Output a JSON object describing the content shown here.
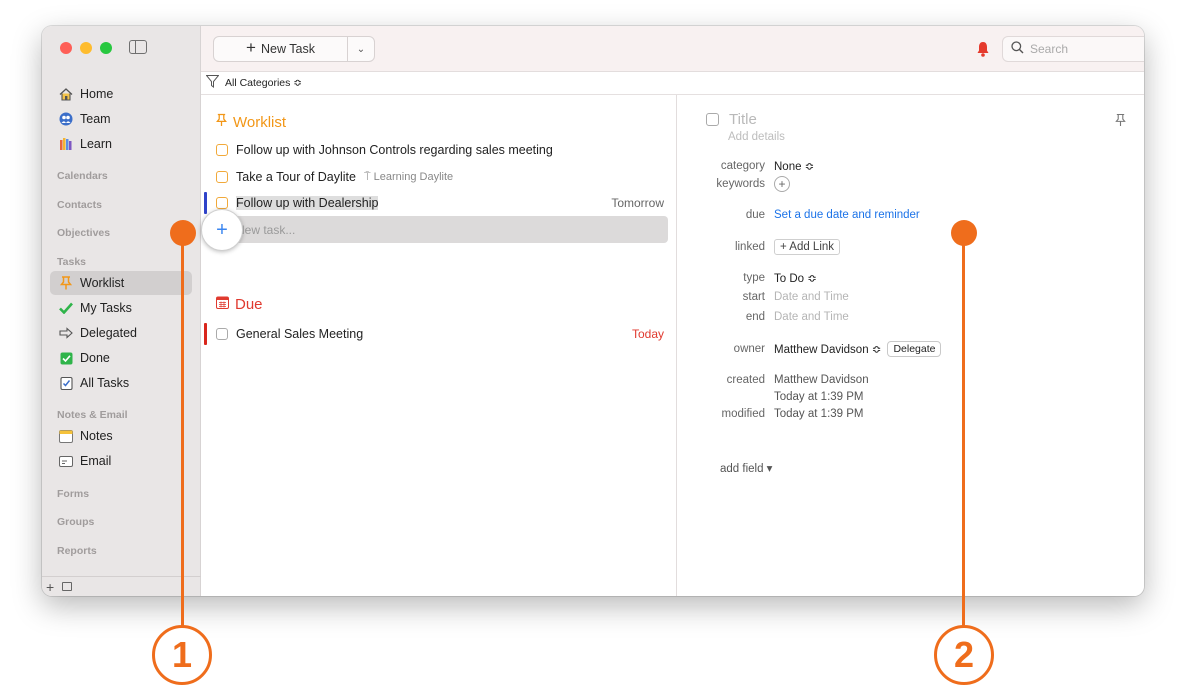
{
  "sidebar": {
    "items": [
      {
        "label": "Home",
        "icon": "home-icon"
      },
      {
        "label": "Team",
        "icon": "team-icon"
      },
      {
        "label": "Learn",
        "icon": "learn-icon"
      }
    ],
    "sections": {
      "calendars": "Calendars",
      "contacts": "Contacts",
      "objectives": "Objectives",
      "tasks": "Tasks",
      "notes_email": "Notes & Email",
      "forms": "Forms",
      "groups": "Groups",
      "reports": "Reports"
    },
    "task_items": [
      {
        "label": "Worklist",
        "icon": "pin-icon",
        "selected": true
      },
      {
        "label": "My Tasks",
        "icon": "checkmark-icon"
      },
      {
        "label": "Delegated",
        "icon": "arrow-right-icon"
      },
      {
        "label": "Done",
        "icon": "checked-box-icon"
      },
      {
        "label": "All Tasks",
        "icon": "all-tasks-icon"
      }
    ],
    "notes_items": [
      {
        "label": "Notes",
        "icon": "notes-icon"
      },
      {
        "label": "Email",
        "icon": "email-icon"
      }
    ],
    "bottom": {
      "add": "+"
    }
  },
  "toolbar": {
    "new_task_label": "New Task",
    "search_placeholder": "Search"
  },
  "filter": {
    "label": "All Categories ≎"
  },
  "worklist": {
    "title": "Worklist",
    "tasks": [
      {
        "title": "Follow up with Johnson Controls regarding sales meeting",
        "tag": "",
        "due": ""
      },
      {
        "title": "Take a Tour of Daylite",
        "tag": "Learning Daylite",
        "due": ""
      },
      {
        "title": "Follow up with Dealership",
        "tag": "",
        "due": "Tomorrow"
      }
    ],
    "new_task_placeholder": "New task..."
  },
  "due_section": {
    "title": "Due",
    "tasks": [
      {
        "title": "General Sales Meeting",
        "due": "Today"
      }
    ]
  },
  "detail": {
    "title_placeholder": "Title",
    "details_placeholder": "Add details",
    "category_label": "category",
    "category_value": "None ≎",
    "keywords_label": "keywords",
    "due_label": "due",
    "due_value": "Set a due date and reminder",
    "linked_label": "linked",
    "add_link": "+ Add Link",
    "type_label": "type",
    "type_value": "To Do ≎",
    "start_label": "start",
    "start_value": "Date and Time",
    "end_label": "end",
    "end_value": "Date and Time",
    "owner_label": "owner",
    "owner_value": "Matthew Davidson ≎",
    "delegate_button": "Delegate",
    "created_label": "created",
    "created_by": "Matthew Davidson",
    "created_time": "Today at 1:39 PM",
    "modified_label": "modified",
    "modified_time": "Today at 1:39 PM",
    "add_field": "add field ▾"
  },
  "callouts": [
    "1",
    "2"
  ],
  "colors": {
    "accent_orange": "#f29718",
    "due_red": "#e03a2f",
    "link_blue": "#1c73e8",
    "callout": "#ef6d1c"
  }
}
